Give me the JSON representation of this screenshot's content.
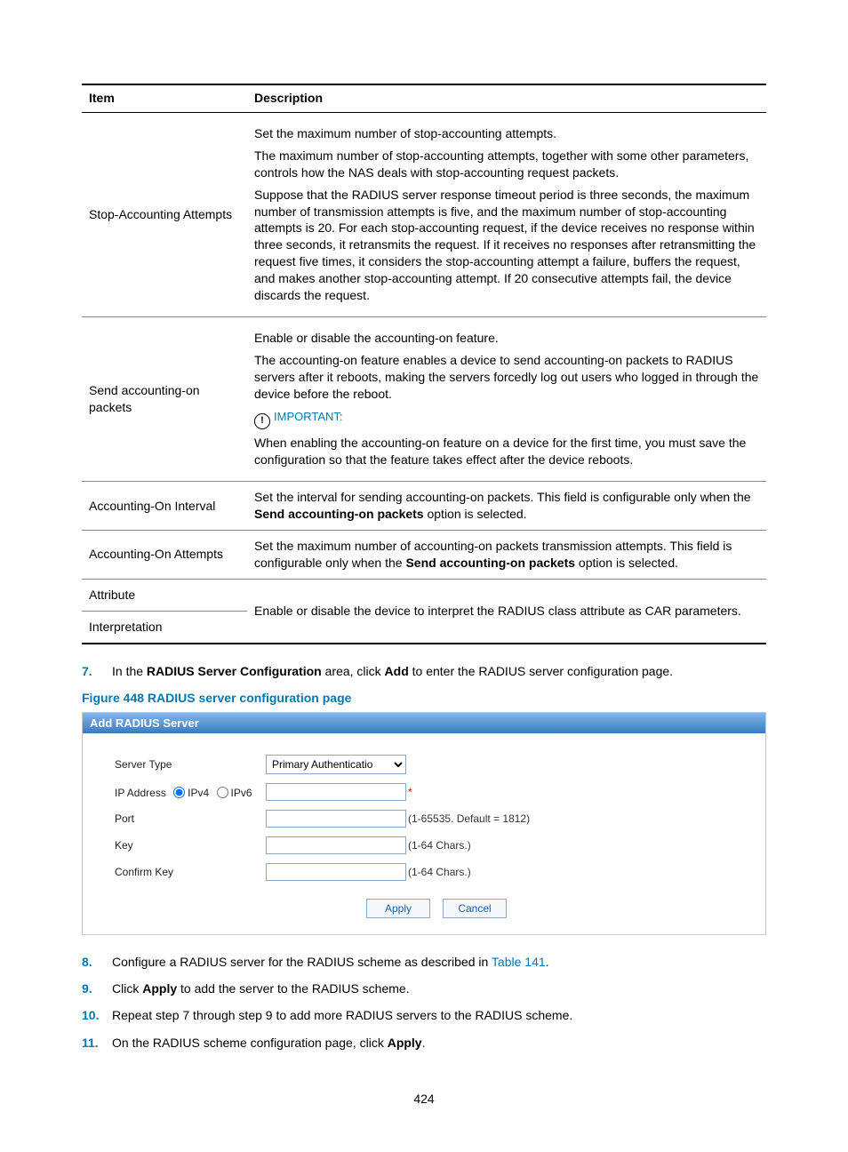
{
  "table": {
    "headers": {
      "item": "Item",
      "desc": "Description"
    },
    "rows": [
      {
        "item": "Stop-Accounting Attempts",
        "desc": {
          "p1": "Set the maximum number of stop-accounting attempts.",
          "p2": "The maximum number of stop-accounting attempts, together with some other parameters, controls how the NAS deals with stop-accounting request packets.",
          "p3": "Suppose that the RADIUS server response timeout period is three seconds, the maximum number of transmission attempts is five, and the maximum number of stop-accounting attempts is 20. For each stop-accounting request, if the device receives no response within three seconds, it retransmits the request. If it receives no responses after retransmitting the request five times, it considers the stop-accounting attempt a failure, buffers the request, and makes another stop-accounting attempt. If 20 consecutive attempts fail, the device discards the request."
        }
      },
      {
        "item": "Send accounting-on packets",
        "desc": {
          "p1": "Enable or disable the accounting-on feature.",
          "p2": "The accounting-on feature enables a device to send accounting-on packets to RADIUS servers after it reboots, making the servers forcedly log out users who logged in through the device before the reboot.",
          "imp_label": "IMPORTANT:",
          "p3": "When enabling the accounting-on feature on a device for the first time, you must save the configuration so that the feature takes effect after the device reboots."
        }
      },
      {
        "item": "Accounting-On Interval",
        "desc_pre": "Set the interval for sending accounting-on packets. This field is configurable only when the ",
        "desc_bold": "Send accounting-on packets",
        "desc_post": " option is selected."
      },
      {
        "item": "Accounting-On Attempts",
        "desc_pre": "Set the maximum number of accounting-on packets transmission attempts. This field is configurable only when the ",
        "desc_bold": "Send accounting-on packets",
        "desc_post": " option is selected."
      },
      {
        "item1": "Attribute",
        "item2": "Interpretation",
        "desc": "Enable or disable the device to interpret the RADIUS class attribute as CAR parameters."
      }
    ]
  },
  "steps": {
    "s7": {
      "num": "7.",
      "pre": "In the ",
      "b1": "RADIUS Server Configuration",
      "mid": " area, click ",
      "b2": "Add",
      "post": " to enter the RADIUS server configuration page."
    },
    "s8": {
      "num": "8.",
      "pre": "Configure a RADIUS server for the RADIUS scheme as described in ",
      "link": "Table 141",
      "post": "."
    },
    "s9": {
      "num": "9.",
      "pre": "Click ",
      "b1": "Apply",
      "post": " to add the server to the RADIUS scheme."
    },
    "s10": {
      "num": "10.",
      "text": "Repeat step 7 through step 9 to add more RADIUS servers to the RADIUS scheme."
    },
    "s11": {
      "num": "11.",
      "pre": "On the RADIUS scheme configuration page, click ",
      "b1": "Apply",
      "post": "."
    }
  },
  "figure_caption": "Figure 448 RADIUS server configuration page",
  "form": {
    "title": "Add RADIUS Server",
    "labels": {
      "server_type": "Server Type",
      "ip_address": "IP Address",
      "ipv4": "IPv4",
      "ipv6": "IPv6",
      "port": "Port",
      "key": "Key",
      "confirm_key": "Confirm Key"
    },
    "values": {
      "server_type": "Primary Authenticatio",
      "ip_address": "",
      "port": "",
      "key": "",
      "confirm_key": ""
    },
    "hints": {
      "port": "(1-65535. Default = 1812)",
      "key": "(1-64 Chars.)",
      "confirm_key": "(1-64 Chars.)"
    },
    "required": "*",
    "buttons": {
      "apply": "Apply",
      "cancel": "Cancel"
    }
  },
  "page_number": "424"
}
